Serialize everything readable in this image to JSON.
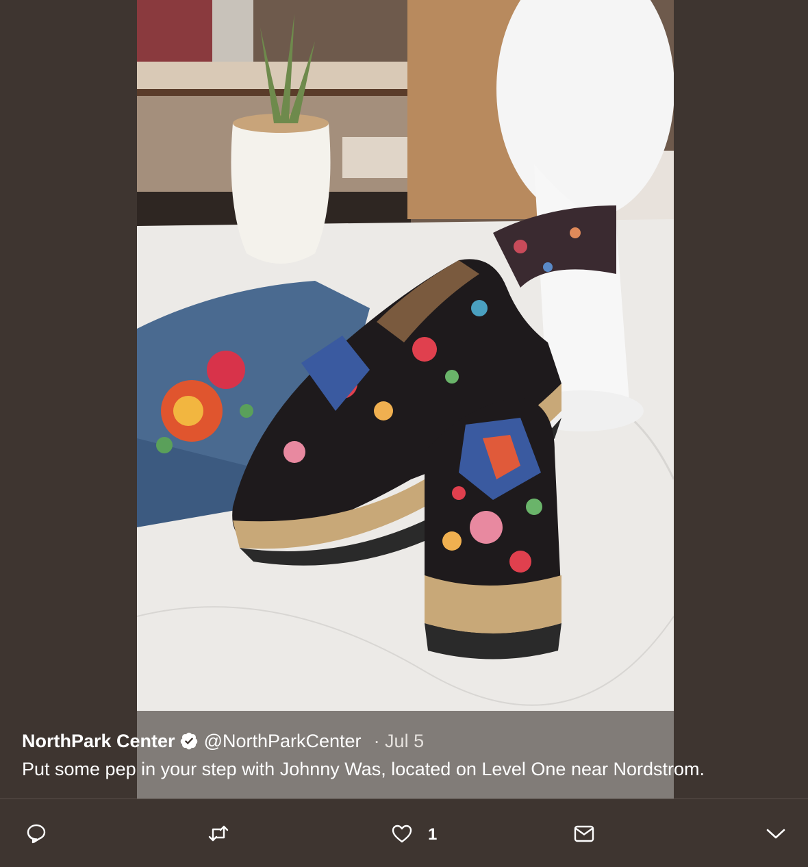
{
  "tweet": {
    "author_name": "NorthPark Center",
    "verified_icon": "verified-badge-icon",
    "handle": "@NorthParkCenter",
    "date": "· Jul 5",
    "text": "Put some pep in your step with Johnny Was, located on Level One near Nordstrom."
  },
  "actions": {
    "reply_icon": "reply-icon",
    "retweet_icon": "retweet-icon",
    "like_icon": "heart-icon",
    "like_count": "1",
    "dm_icon": "mail-icon",
    "more_icon": "chevron-down-icon"
  },
  "colors": {
    "background": "#3e3530",
    "text": "#ffffff",
    "overlay": "#6e6864"
  }
}
